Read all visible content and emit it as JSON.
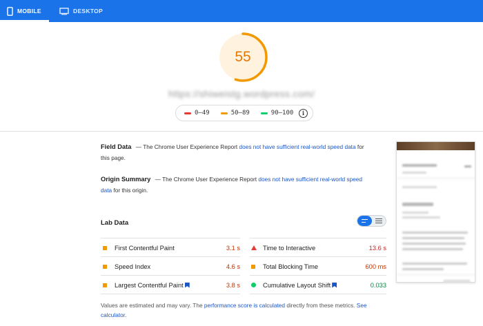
{
  "tabs": [
    {
      "label": "MOBILE",
      "icon": "phone-icon",
      "active": true
    },
    {
      "label": "DESKTOP",
      "icon": "desktop-icon",
      "active": false
    }
  ],
  "score": {
    "value": 55,
    "fraction": 0.55,
    "color": "#e67700"
  },
  "url": "https://shiweistg.wordpress.com/",
  "legend": [
    {
      "label": "0–49",
      "color": "#e53935"
    },
    {
      "label": "50–89",
      "color": "#f29900"
    },
    {
      "label": "90–100",
      "color": "#0cce6b"
    }
  ],
  "field_data": {
    "title": "Field Data",
    "prefix": "— The Chrome User Experience Report",
    "link": "does not have sufficient real-world speed data",
    "suffix": "for this page."
  },
  "origin_summary": {
    "title": "Origin Summary",
    "prefix": "— The Chrome User Experience Report",
    "link": "does not have sufficient real-world speed data",
    "suffix": "for this origin."
  },
  "lab": {
    "title": "Lab Data",
    "metrics_left": [
      {
        "label": "First Contentful Paint",
        "value": "3.1 s",
        "status": "average",
        "color": "#c33300",
        "flag": false
      },
      {
        "label": "Speed Index",
        "value": "4.6 s",
        "status": "average",
        "color": "#c33300",
        "flag": false
      },
      {
        "label": "Largest Contentful Paint",
        "value": "3.8 s",
        "status": "average",
        "color": "#c33300",
        "flag": true
      }
    ],
    "metrics_right": [
      {
        "label": "Time to Interactive",
        "value": "13.6 s",
        "status": "fail",
        "color": "#c7221f",
        "flag": false
      },
      {
        "label": "Total Blocking Time",
        "value": "600 ms",
        "status": "average",
        "color": "#c33300",
        "flag": false
      },
      {
        "label": "Cumulative Layout Shift",
        "value": "0.033",
        "status": "pass",
        "color": "#018642",
        "flag": true
      }
    ]
  },
  "footer": {
    "text1": "Values are estimated and may vary. The",
    "link1": "performance score is calculated",
    "text2": "directly from these metrics.",
    "link2": "See calculator."
  },
  "icons": {
    "info": "info-icon",
    "toggle": "view-toggle"
  }
}
